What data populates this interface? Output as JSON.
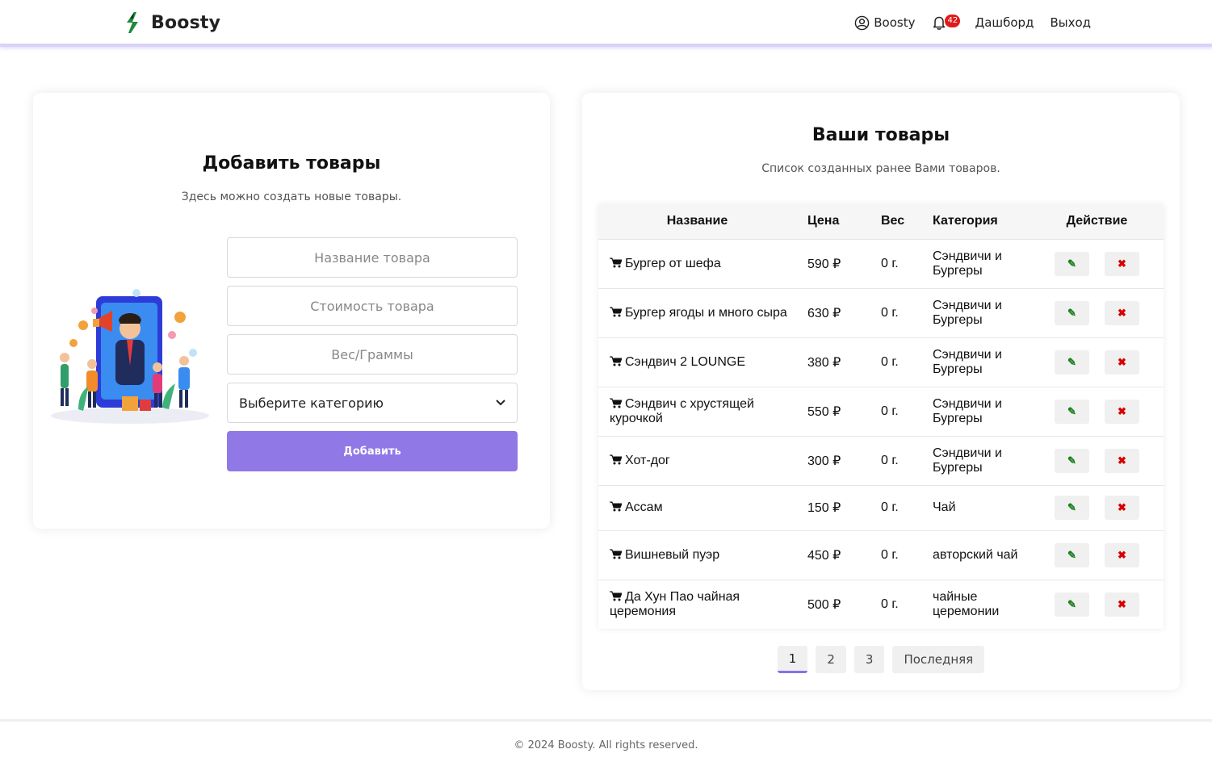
{
  "header": {
    "brand": "Boosty",
    "nav": {
      "profile_label": "Boosty",
      "notification_count": "42",
      "dashboard_label": "Дашборд",
      "logout_label": "Выход"
    }
  },
  "add_card": {
    "title": "Добавить товары",
    "subtitle": "Здесь можно создать новые товары.",
    "name_placeholder": "Название товара",
    "price_placeholder": "Стоимость товара",
    "weight_placeholder": "Вес/Граммы",
    "category_selected": "Выберите категорию",
    "add_button": "Добавить"
  },
  "list_card": {
    "title": "Ваши товары",
    "subtitle": "Список созданных ранее Вами товаров.",
    "columns": [
      "Название",
      "Цена",
      "Вес",
      "Категория",
      "Действие"
    ],
    "rows": [
      {
        "name": "Бургер от шефа",
        "price": "590 ₽",
        "weight": "0 г.",
        "category": "Сэндвичи и Бургеры"
      },
      {
        "name": "Бургер ягоды и много сыра",
        "price": "630 ₽",
        "weight": "0 г.",
        "category": "Сэндвичи и Бургеры"
      },
      {
        "name": "Сэндвич 2 LOUNGE",
        "price": "380 ₽",
        "weight": "0 г.",
        "category": "Сэндвичи и Бургеры"
      },
      {
        "name": "Сэндвич с хрустящей курочкой",
        "price": "550 ₽",
        "weight": "0 г.",
        "category": "Сэндвичи и Бургеры"
      },
      {
        "name": "Хот-дог",
        "price": "300 ₽",
        "weight": "0 г.",
        "category": "Сэндвичи и Бургеры"
      },
      {
        "name": "Ассам",
        "price": "150 ₽",
        "weight": "0 г.",
        "category": "Чай"
      },
      {
        "name": "Вишневый пуэр",
        "price": "450 ₽",
        "weight": "0 г.",
        "category": "авторский чай"
      },
      {
        "name": "Да Хун Пао чайная церемония",
        "price": "500 ₽",
        "weight": "0 г.",
        "category": "чайные церемонии"
      }
    ],
    "edit_glyph": "✎",
    "delete_glyph": "✖",
    "pagination": [
      "1",
      "2",
      "3",
      "Последняя"
    ],
    "active_page": "1"
  },
  "footer": {
    "text": "© 2024 Boosty. All rights reserved."
  },
  "colors": {
    "accent": "#9078e6",
    "badge": "#e01b1b",
    "edit": "#1b7b1b",
    "delete": "#d80000"
  },
  "icons": [
    "boosty-logo-icon",
    "user-circle-icon",
    "bell-icon",
    "chevron-down-icon",
    "cart-icon",
    "pencil-icon",
    "x-icon"
  ]
}
